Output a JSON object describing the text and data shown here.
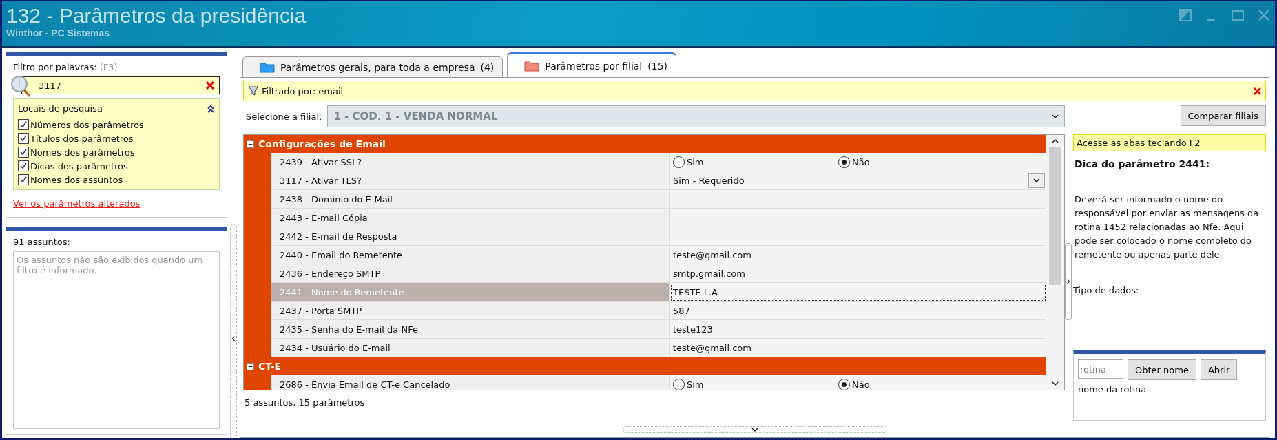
{
  "window": {
    "title": "132 - Parâmetros da presidência",
    "subtitle": "Winthor - PC Sistemas"
  },
  "filter_panel": {
    "label": "Filtro por palavras:",
    "shortcut": "(F3)",
    "search_value": "3117",
    "search_locations": {
      "title": "Locais de pesquisa",
      "expanded": true,
      "options": [
        {
          "label": "Números dos parâmetros",
          "checked": true
        },
        {
          "label": "Títulos dos parâmetros",
          "checked": true
        },
        {
          "label": "Nomes dos parâmetros",
          "checked": true
        },
        {
          "label": "Dicas dos parâmetros",
          "checked": true
        },
        {
          "label": "Nomes dos assuntos",
          "checked": true
        }
      ]
    },
    "link": "Ver os parâmetros alterados"
  },
  "subjects_panel": {
    "count_label": "91 assuntos:",
    "message": "Os assuntos não são exibidos quando um filtro é informado."
  },
  "tabs": [
    {
      "label": "Parâmetros gerais, para toda a empresa",
      "count": "(4)",
      "selected": false
    },
    {
      "label": "Parâmetros por filial",
      "count": "(15)",
      "selected": true
    }
  ],
  "filter_bar": {
    "text": "Filtrado por: email"
  },
  "branch_select": {
    "label": "Selecione a filial:",
    "value": "1 - COD. 1 - VENDA NORMAL"
  },
  "compare_button": "Comparar filiais",
  "groups": [
    {
      "title": "Configurações de Email",
      "expanded": true,
      "rows": [
        {
          "label": "2439 - Ativar SSL?",
          "kind": "radio",
          "selected": false,
          "options": [
            {
              "label": "Sim",
              "selected": false
            },
            {
              "label": "Não",
              "selected": true
            }
          ]
        },
        {
          "label": "3117 - Ativar TLS?",
          "kind": "combo",
          "selected": false,
          "value": "Sim - Requerido"
        },
        {
          "label": "2438 - Dominio do E-Mail",
          "kind": "text",
          "selected": false
        },
        {
          "label": "2443 - E-mail Cópia",
          "kind": "text",
          "selected": false
        },
        {
          "label": "2442 - E-mail de Resposta",
          "kind": "text",
          "selected": false
        },
        {
          "label": "2440 - Email do Remetente",
          "kind": "text",
          "selected": false,
          "value": "teste@gmail.com"
        },
        {
          "label": "2436 - Endereço SMTP",
          "kind": "text",
          "selected": false,
          "value": "smtp.gmail.com"
        },
        {
          "label": "2441 - Nome do Remetente",
          "kind": "text",
          "selected": true,
          "value": "TESTE L.A"
        },
        {
          "label": "2437 - Porta SMTP",
          "kind": "text",
          "selected": false,
          "value": "587"
        },
        {
          "label": "2435 - Senha do E-mail da NFe",
          "kind": "text",
          "selected": false,
          "value": "teste123"
        },
        {
          "label": "2434 - Usuário do E-mail",
          "kind": "text",
          "selected": false,
          "value": "teste@gmail.com"
        }
      ]
    },
    {
      "title": "CT-E",
      "expanded": true,
      "rows": [
        {
          "label": "2686 - Envia Email de CT-e Cancelado",
          "kind": "radio",
          "selected": false,
          "options": [
            {
              "label": "Sim",
              "selected": false
            },
            {
              "label": "Não",
              "selected": true
            }
          ]
        }
      ]
    }
  ],
  "status": "5 assuntos, 15 parâmetros",
  "hint_panel": {
    "shortcut_tip": "Acesse as abas teclando F2",
    "title": "Dica do parâmetro 2441:",
    "text": "Deverá ser informado o nome do responsável por enviar as mensagens da rotina 1452 relacionadas ao Nfe. Aqui pode ser colocado o nome completo do remetente ou apenas parte dele.",
    "data_type_label": "Tipo de dados:"
  },
  "routine": {
    "placeholder": "rotina",
    "get_name_button": "Obter nome",
    "open_button": "Abrir",
    "name_text": "nome da rotina"
  }
}
